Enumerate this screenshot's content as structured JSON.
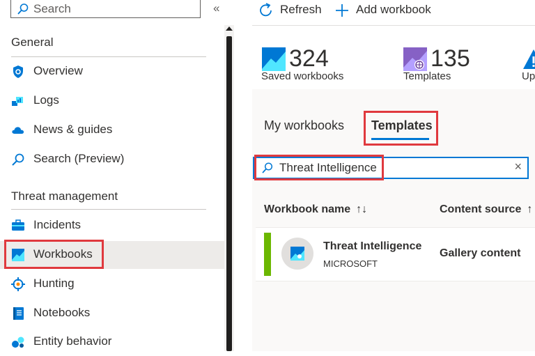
{
  "sidebar": {
    "search_placeholder": "Search",
    "collapse_glyph": "«",
    "sections": [
      {
        "title": "General",
        "items": [
          {
            "label": "Overview",
            "icon": "shield-icon"
          },
          {
            "label": "Logs",
            "icon": "logs-icon"
          },
          {
            "label": "News & guides",
            "icon": "cloud-icon"
          },
          {
            "label": "Search (Preview)",
            "icon": "search-icon"
          }
        ]
      },
      {
        "title": "Threat management",
        "items": [
          {
            "label": "Incidents",
            "icon": "briefcase-icon"
          },
          {
            "label": "Workbooks",
            "icon": "workbook-icon",
            "selected": true
          },
          {
            "label": "Hunting",
            "icon": "target-icon"
          },
          {
            "label": "Notebooks",
            "icon": "notebook-icon"
          },
          {
            "label": "Entity behavior",
            "icon": "entity-icon"
          }
        ]
      }
    ]
  },
  "toolbar": {
    "refresh_label": "Refresh",
    "add_workbook_label": "Add workbook"
  },
  "stats": [
    {
      "value": "324",
      "caption": "Saved workbooks",
      "icon": "workbook-icon"
    },
    {
      "value": "135",
      "caption": "Templates",
      "icon": "templates-icon"
    },
    {
      "value": "",
      "caption": "Up",
      "icon": "warning-icon"
    }
  ],
  "tabs": [
    {
      "label": "My workbooks",
      "active": false
    },
    {
      "label": "Templates",
      "active": true
    }
  ],
  "workbook_search": {
    "value": "Threat Intelligence",
    "clear_glyph": "×"
  },
  "table": {
    "columns": [
      {
        "label": "Workbook name",
        "sort_glyph": "↑↓"
      },
      {
        "label": "Content source",
        "sort_glyph": "↑"
      }
    ],
    "rows": [
      {
        "name": "Threat Intelligence",
        "publisher": "MICROSOFT",
        "source": "Gallery content"
      }
    ]
  },
  "colors": {
    "accent": "#0078d4",
    "highlight": "#e0393e",
    "row_bar": "#6bb700",
    "selected_bg": "#edebe9"
  }
}
